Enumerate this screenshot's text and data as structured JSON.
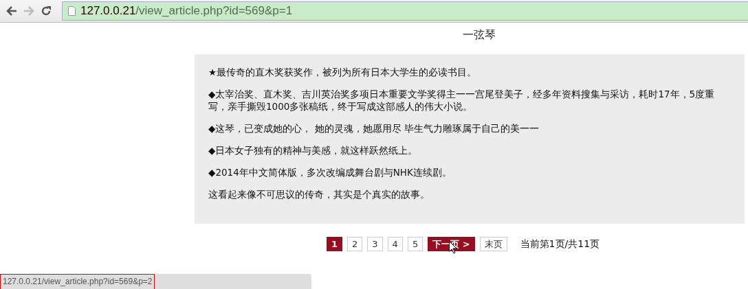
{
  "browser": {
    "url_host": "127.0.0.21",
    "url_path": "/view_article.php?id=569&p=1"
  },
  "article": {
    "title": "一弦琴",
    "paragraphs": [
      "★最传奇的直木奖获奖作，被列为所有日本大学生的必读书目。",
      "◆太宰治奖、直木奖、吉川英治奖多项日本重要文学奖得主一一宫尾登美子，经多年资料搜集与采访，耗时17年，5度重写，亲手撕毁1000多张稿纸，终于写成这部感人的伟大小说。",
      "◆这琴，已变成她的心，  她的灵魂，她愿用尽 毕生气力雕琢属于自己的美一一",
      "◆日本女子独有的精神与美感，就这样跃然纸上。",
      "◆2014年中文简体版，多次改编成舞台剧与NHK连续剧。",
      "这看起来像不可思议的传奇，其实是个真实的故事。"
    ]
  },
  "pagination": {
    "pages": [
      {
        "label": "1",
        "selected": true
      },
      {
        "label": "2",
        "selected": false
      },
      {
        "label": "3",
        "selected": false
      },
      {
        "label": "4",
        "selected": false
      },
      {
        "label": "5",
        "selected": false
      }
    ],
    "next": {
      "label": "下一页 >",
      "hovered": true
    },
    "last": {
      "label": "末页",
      "hovered": false
    },
    "info": "当前第1页/共11页"
  },
  "status_bar": {
    "url": "127.0.0.21/view_article.php?id=569&p=2"
  }
}
